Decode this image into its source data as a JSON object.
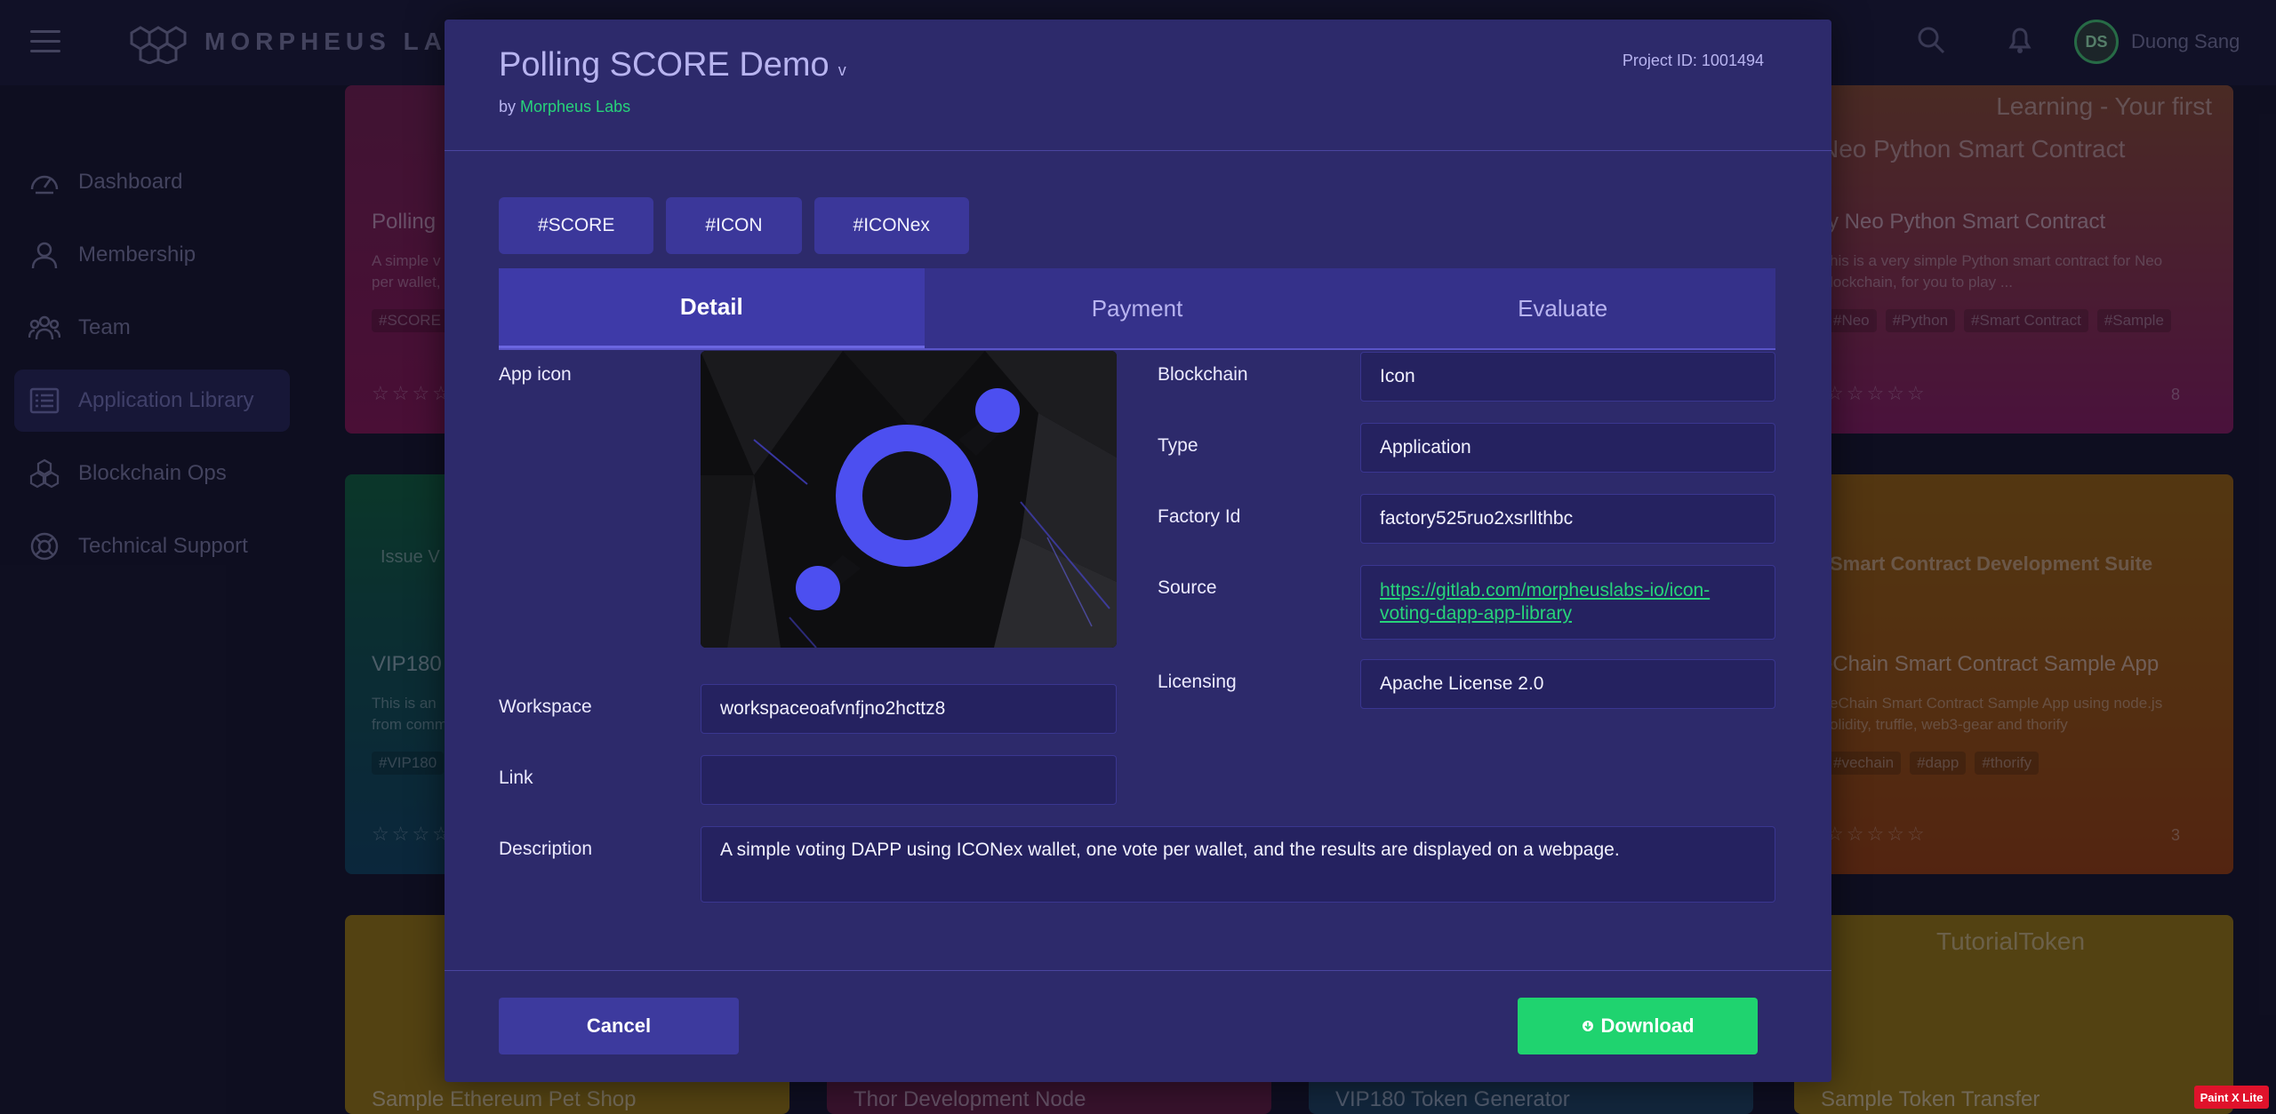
{
  "header": {
    "logo_text": "MORPHEUS LABS",
    "user_initials": "DS",
    "user_name": "Duong Sang"
  },
  "sidebar": {
    "items": [
      {
        "label": "Dashboard",
        "icon": "gauge-icon"
      },
      {
        "label": "Membership",
        "icon": "user-icon"
      },
      {
        "label": "Team",
        "icon": "team-icon"
      },
      {
        "label": "Application Library",
        "icon": "list-icon",
        "active": true
      },
      {
        "label": "Blockchain Ops",
        "icon": "cubes-icon"
      },
      {
        "label": "Technical Support",
        "icon": "lifebuoy-icon"
      }
    ]
  },
  "background_cards": [
    {
      "title": "Polling",
      "desc1": "A simple v",
      "desc2": "per wallet,",
      "tag": "#SCORE"
    },
    {
      "title": "VIP180",
      "desc1": "This is an",
      "desc2": "from comm",
      "tag": "#VIP180",
      "banner": "Issue V"
    },
    {
      "title": "Sample Ethereum Pet Shop"
    },
    {
      "title": "Thor Development Node"
    },
    {
      "title": "VIP180 Token Generator"
    },
    {
      "title": "ry Neo Python Smart Contract",
      "desc1": "his is a very simple Python smart contract for Neo",
      "desc2": "lockchain, for you to play ...",
      "tags": [
        "#Neo",
        "#Python",
        "#Smart Contract",
        "#Sample"
      ],
      "count": "8",
      "banner": "Learning - Your first",
      "banner2": "Neo Python Smart Contract"
    },
    {
      "title": "eChain Smart Contract Sample App",
      "desc1": "eChain Smart Contract Sample App using node.js",
      "desc2": "olidity, truffle, web3-gear and thorify",
      "tags": [
        "#vechain",
        "#dapp",
        "#thorify"
      ],
      "count": "3",
      "banner": "Smart Contract Development Suite"
    },
    {
      "title": "Sample Token Transfer",
      "banner": "TutorialToken"
    }
  ],
  "modal": {
    "title": "Polling SCORE Demo",
    "title_caret": "v",
    "by_prefix": "by ",
    "author": "Morpheus Labs",
    "project_id": "Project ID: 1001494",
    "tags": [
      "#SCORE",
      "#ICON",
      "#ICONex"
    ],
    "tabs": [
      "Detail",
      "Payment",
      "Evaluate"
    ],
    "active_tab": "Detail",
    "fields": {
      "app_icon_label": "App icon",
      "workspace_label": "Workspace",
      "workspace_value": "workspaceoafvnfjno2hcttz8",
      "link_label": "Link",
      "link_value": "",
      "description_label": "Description",
      "description_value": "A simple voting DAPP using ICONex wallet, one vote per wallet, and the results are displayed on a webpage.",
      "blockchain_label": "Blockchain",
      "blockchain_value": "Icon",
      "type_label": "Type",
      "type_value": "Application",
      "factory_label": "Factory Id",
      "factory_value": "factory525ruo2xsrllthbc",
      "source_label": "Source",
      "source_value": "https://gitlab.com/morpheuslabs-io/icon-voting-dapp-app-library",
      "licensing_label": "Licensing",
      "licensing_value": "Apache License 2.0"
    },
    "cancel_label": "Cancel",
    "download_label": "Download"
  },
  "badge": "Paint X Lite",
  "colors": {
    "modal_bg": "#2d2a6b",
    "accent_green": "#1fd36f",
    "link_green": "#27d37a",
    "tab_active": "#3e3aa8"
  }
}
